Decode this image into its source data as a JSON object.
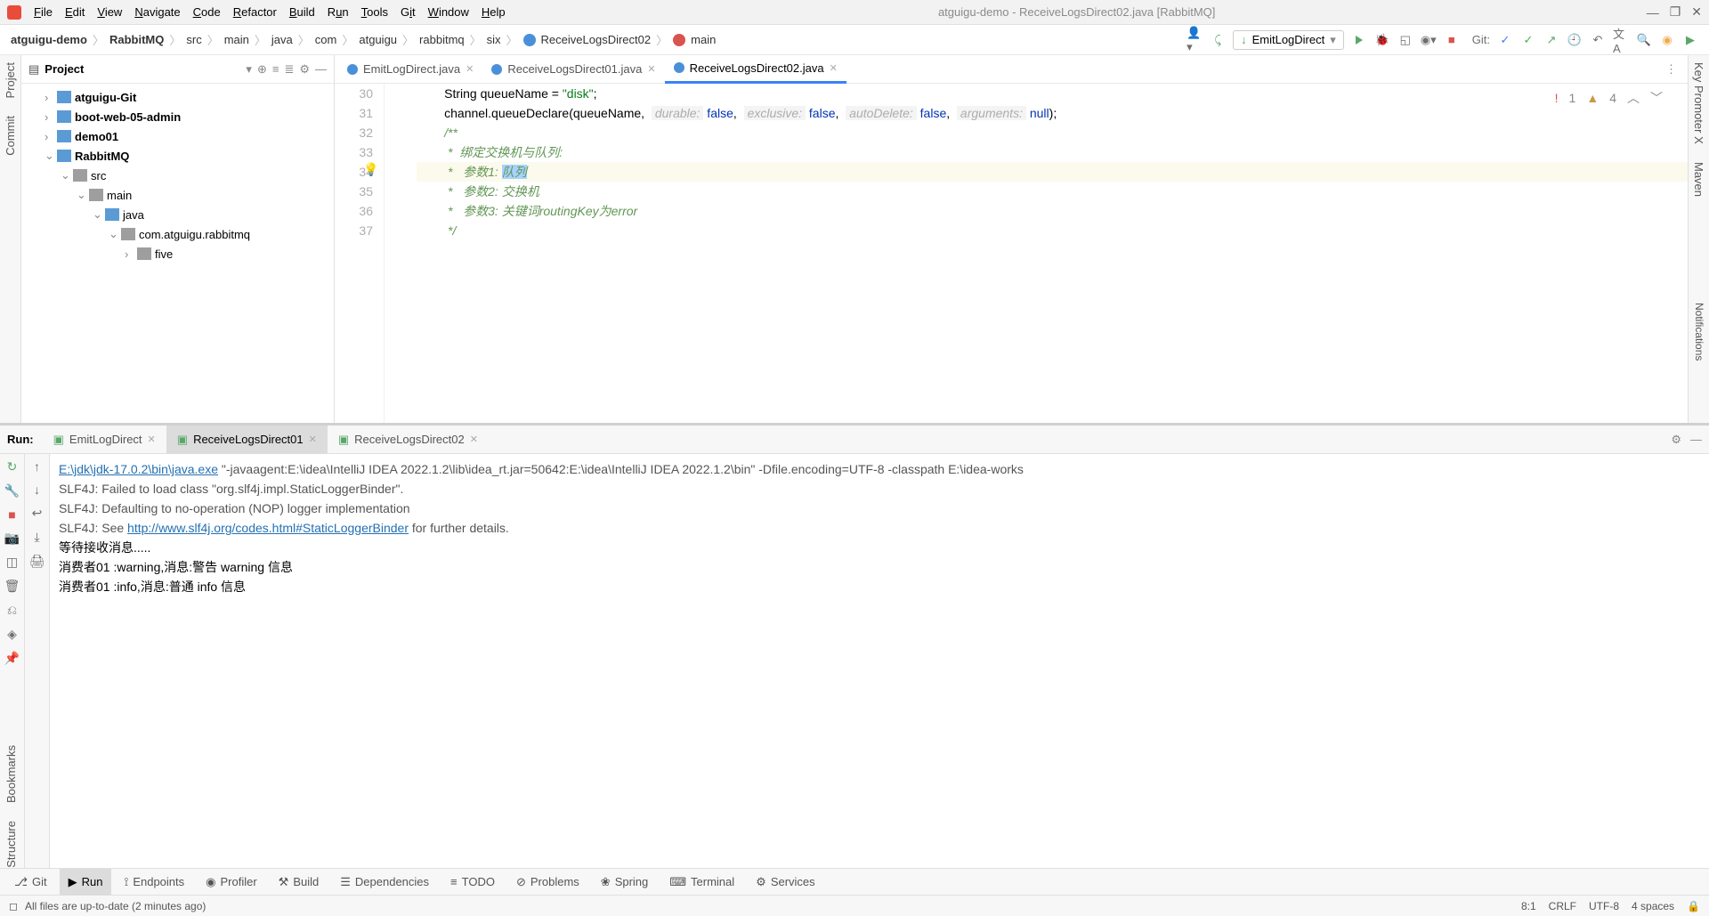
{
  "window": {
    "title": "atguigu-demo - ReceiveLogsDirect02.java [RabbitMQ]"
  },
  "menu": [
    "File",
    "Edit",
    "View",
    "Navigate",
    "Code",
    "Refactor",
    "Build",
    "Run",
    "Tools",
    "Git",
    "Window",
    "Help"
  ],
  "breadcrumb": [
    "atguigu-demo",
    "RabbitMQ",
    "src",
    "main",
    "java",
    "com",
    "atguigu",
    "rabbitmq",
    "six",
    "ReceiveLogsDirect02",
    "main"
  ],
  "run_config": "EmitLogDirect",
  "git_label": "Git:",
  "project": {
    "title": "Project",
    "nodes": [
      {
        "indent": 1,
        "arrow": ">",
        "type": "blue",
        "label": "atguigu-Git",
        "bold": true
      },
      {
        "indent": 1,
        "arrow": ">",
        "type": "blue",
        "label": "boot-web-05-admin",
        "bold": true
      },
      {
        "indent": 1,
        "arrow": ">",
        "type": "blue",
        "label": "demo01",
        "bold": true
      },
      {
        "indent": 1,
        "arrow": "v",
        "type": "blue",
        "label": "RabbitMQ",
        "bold": true
      },
      {
        "indent": 2,
        "arrow": "v",
        "type": "gray",
        "label": "src",
        "bold": false
      },
      {
        "indent": 3,
        "arrow": "v",
        "type": "gray",
        "label": "main",
        "bold": false
      },
      {
        "indent": 4,
        "arrow": "v",
        "type": "blue",
        "label": "java",
        "bold": false
      },
      {
        "indent": 5,
        "arrow": "v",
        "type": "gray",
        "label": "com.atguigu.rabbitmq",
        "bold": false
      },
      {
        "indent": 6,
        "arrow": ">",
        "type": "gray",
        "label": "five",
        "bold": false
      }
    ]
  },
  "editor_tabs": [
    {
      "label": "EmitLogDirect.java",
      "active": false
    },
    {
      "label": "ReceiveLogsDirect01.java",
      "active": false
    },
    {
      "label": "ReceiveLogsDirect02.java",
      "active": true
    }
  ],
  "editor_status": {
    "err": "1",
    "warn": "4"
  },
  "gutter": [
    "30",
    "31",
    "32",
    "33",
    "34",
    "35",
    "36",
    "37"
  ],
  "code": {
    "l30_a": "        String queueName = ",
    "l30_b": "\"disk\"",
    "l30_c": ";",
    "l31_a": "        channel.queueDeclare(queueName,  ",
    "l31_h1": "durable:",
    "l31_v1": " false",
    "l31_c1": ",  ",
    "l31_h2": "exclusive:",
    "l31_v2": " false",
    "l31_c2": ",  ",
    "l31_h3": "autoDelete:",
    "l31_v3": " false",
    "l31_c3": ",  ",
    "l31_h4": "arguments:",
    "l31_v4": " null",
    "l31_c4": ");",
    "l32": "        /**",
    "l33": "         *  绑定交换机与队列:",
    "l34_a": "         *   参数1: ",
    "l34_b": "队列",
    "l35": "         *   参数2: 交换机",
    "l36": "         *   参数3: 关键词routingKey为error",
    "l37": "         */"
  },
  "run": {
    "label": "Run:",
    "tabs": [
      {
        "label": "EmitLogDirect",
        "active": false
      },
      {
        "label": "ReceiveLogsDirect01",
        "active": true
      },
      {
        "label": "ReceiveLogsDirect02",
        "active": false
      }
    ],
    "console": {
      "path": "E:\\jdk\\jdk-17.0.2\\bin\\java.exe",
      "jvm": " \"-javaagent:E:\\idea\\IntelliJ IDEA 2022.1.2\\lib\\idea_rt.jar=50642:E:\\idea\\IntelliJ IDEA 2022.1.2\\bin\" -Dfile.encoding=UTF-8 -classpath E:\\idea-works",
      "l2": "SLF4J: Failed to load class \"org.slf4j.impl.StaticLoggerBinder\".",
      "l3": "SLF4J: Defaulting to no-operation (NOP) logger implementation",
      "l4a": "SLF4J: See ",
      "l4b": "http://www.slf4j.org/codes.html#StaticLoggerBinder",
      "l4c": " for further details.",
      "l5": "等待接收消息.....",
      "l6": " 消费者01 :warning,消息:警告 warning 信息",
      "l7": " 消费者01 :info,消息:普通 info 信息"
    }
  },
  "bottom_tabs": [
    "Git",
    "Run",
    "Endpoints",
    "Profiler",
    "Build",
    "Dependencies",
    "TODO",
    "Problems",
    "Spring",
    "Terminal",
    "Services"
  ],
  "status": {
    "left": "All files are up-to-date (2 minutes ago)",
    "pos": "8:1",
    "eol": "CRLF",
    "enc": "UTF-8",
    "spaces": "4 spaces"
  },
  "left_stripe": [
    "Project",
    "Commit"
  ],
  "left_stripe2": [
    "Bookmarks",
    "Structure"
  ],
  "right_stripe": [
    "Key Promoter X",
    "Maven"
  ],
  "notifications_label": "Notifications"
}
